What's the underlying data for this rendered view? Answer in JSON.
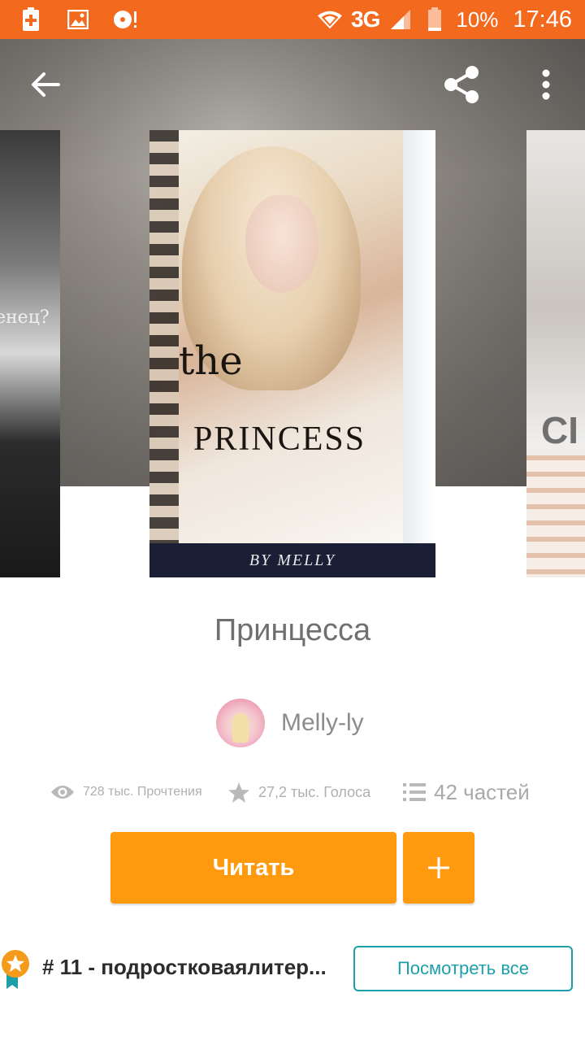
{
  "status_bar": {
    "network": "3G",
    "battery": "10%",
    "time": "17:46"
  },
  "cover": {
    "left_fragment_text": "енец?",
    "main_the": "the",
    "main_title": "PRINCESS",
    "main_author": "BY MELLY",
    "right_fragment_text": "CI"
  },
  "book": {
    "title": "Принцесса",
    "author": "Melly-ly",
    "reads": "728 тыс. Прочтения",
    "votes": "27,2 тыс. Голоса",
    "parts": "42 частей"
  },
  "actions": {
    "read_label": "Читать"
  },
  "ranking": {
    "text": "# 11 - подростковаялитер...",
    "see_all_label": "Посмотреть все"
  },
  "colors": {
    "status_bar": "#f36a1f",
    "accent_orange": "#ff9a0f",
    "teal": "#1d9fa9"
  }
}
